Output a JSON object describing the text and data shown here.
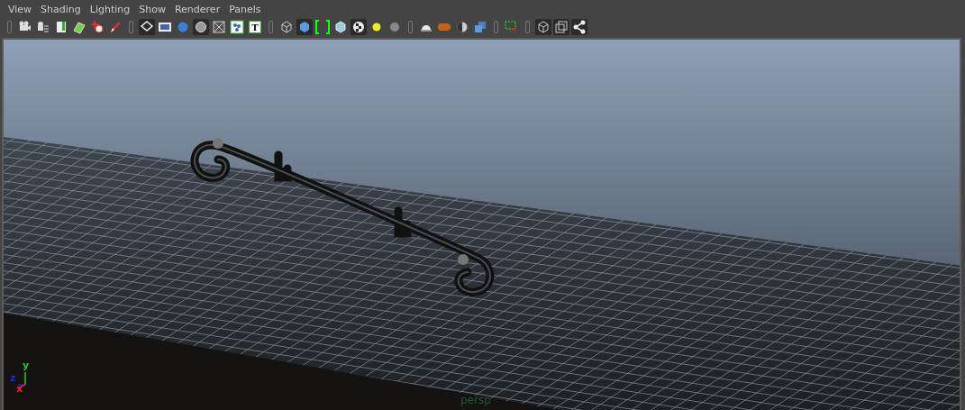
{
  "menu": [
    {
      "label": "View"
    },
    {
      "label": "Shading"
    },
    {
      "label": "Lighting"
    },
    {
      "label": "Show"
    },
    {
      "label": "Renderer"
    },
    {
      "label": "Panels"
    }
  ],
  "toolbar": [
    {
      "icons": [
        {
          "kind": "camera",
          "selected": false
        },
        {
          "kind": "camera-list",
          "selected": false
        },
        {
          "kind": "bookmark",
          "selected": false
        },
        {
          "kind": "image-plane",
          "selected": false
        },
        {
          "kind": "pan-zoom",
          "selected": false
        },
        {
          "kind": "pencil",
          "selected": false
        }
      ]
    },
    {
      "icons": [
        {
          "kind": "grid",
          "selected": true
        },
        {
          "kind": "film",
          "selected": false
        },
        {
          "kind": "sphere",
          "selected": false
        },
        {
          "kind": "circle",
          "selected": true
        },
        {
          "kind": "cross-box",
          "selected": false
        },
        {
          "kind": "dots",
          "selected": false
        },
        {
          "kind": "letter-box",
          "selected": false
        }
      ]
    },
    {
      "icons": [
        {
          "kind": "wire-cube",
          "selected": false
        },
        {
          "kind": "solid-cube",
          "selected": true
        },
        {
          "kind": "bracket-ball",
          "selected": false
        },
        {
          "kind": "light-cube",
          "selected": false
        },
        {
          "kind": "checker-ball",
          "selected": true
        },
        {
          "kind": "glow",
          "selected": false
        },
        {
          "kind": "gray-ball",
          "selected": false
        }
      ]
    },
    {
      "icons": [
        {
          "kind": "dome",
          "selected": false
        },
        {
          "kind": "capsule",
          "selected": false
        },
        {
          "kind": "half-ball",
          "selected": false
        },
        {
          "kind": "cubes",
          "selected": false
        }
      ]
    },
    {
      "icons": [
        {
          "kind": "marquee",
          "selected": false
        }
      ]
    },
    {
      "icons": [
        {
          "kind": "wire-cube",
          "selected": true
        },
        {
          "kind": "squares",
          "selected": true
        },
        {
          "kind": "share",
          "selected": true
        }
      ]
    }
  ],
  "letter_icon_text": "T",
  "viewport": {
    "axis_labels": {
      "y": "y",
      "z": "z",
      "x": "x"
    },
    "camera_label": "persp"
  }
}
